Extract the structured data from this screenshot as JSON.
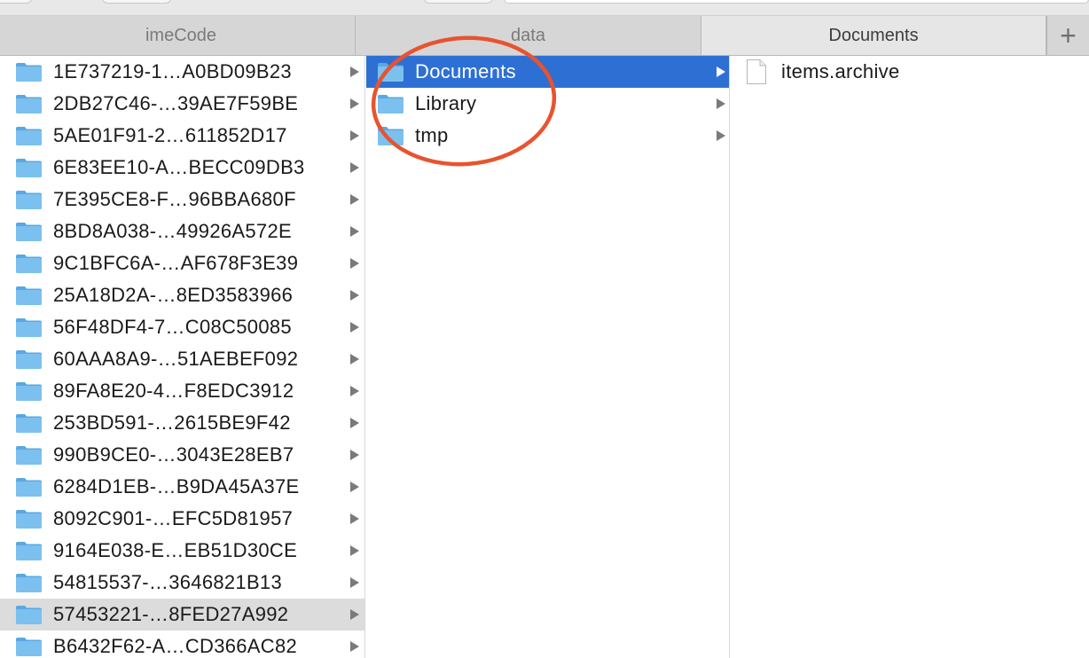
{
  "tabs": [
    {
      "label": "imeCode"
    },
    {
      "label": "data"
    },
    {
      "label": "Documents"
    }
  ],
  "add_tab_label": "+",
  "column1": {
    "items": [
      {
        "label": "1E737219-1…A0BD09B23"
      },
      {
        "label": "2DB27C46-…39AE7F59BE"
      },
      {
        "label": "5AE01F91-2…611852D17"
      },
      {
        "label": "6E83EE10-A…BECC09DB3"
      },
      {
        "label": "7E395CE8-F…96BBA680F"
      },
      {
        "label": "8BD8A038-…49926A572E"
      },
      {
        "label": "9C1BFC6A-…AF678F3E39"
      },
      {
        "label": "25A18D2A-…8ED3583966"
      },
      {
        "label": "56F48DF4-7…C08C50085"
      },
      {
        "label": "60AAA8A9-…51AEBEF092"
      },
      {
        "label": "89FA8E20-4…F8EDC3912"
      },
      {
        "label": "253BD591-…2615BE9F42"
      },
      {
        "label": "990B9CE0-…3043E28EB7"
      },
      {
        "label": "6284D1EB-…B9DA45A37E"
      },
      {
        "label": "8092C901-…EFC5D81957"
      },
      {
        "label": "9164E038-E…EB51D30CE"
      },
      {
        "label": "54815537-…3646821B13"
      },
      {
        "label": "57453221-…8FED27A992"
      },
      {
        "label": "B6432F62-A…CD366AC82"
      }
    ],
    "highlighted_index": 17
  },
  "column2": {
    "items": [
      {
        "label": "Documents"
      },
      {
        "label": "Library"
      },
      {
        "label": "tmp"
      }
    ],
    "selected_index": 0
  },
  "column3": {
    "items": [
      {
        "label": "items.archive"
      }
    ]
  },
  "colors": {
    "selection": "#2e6fd3",
    "annotation": "#e8532f",
    "folder": "#7cc0ef"
  }
}
